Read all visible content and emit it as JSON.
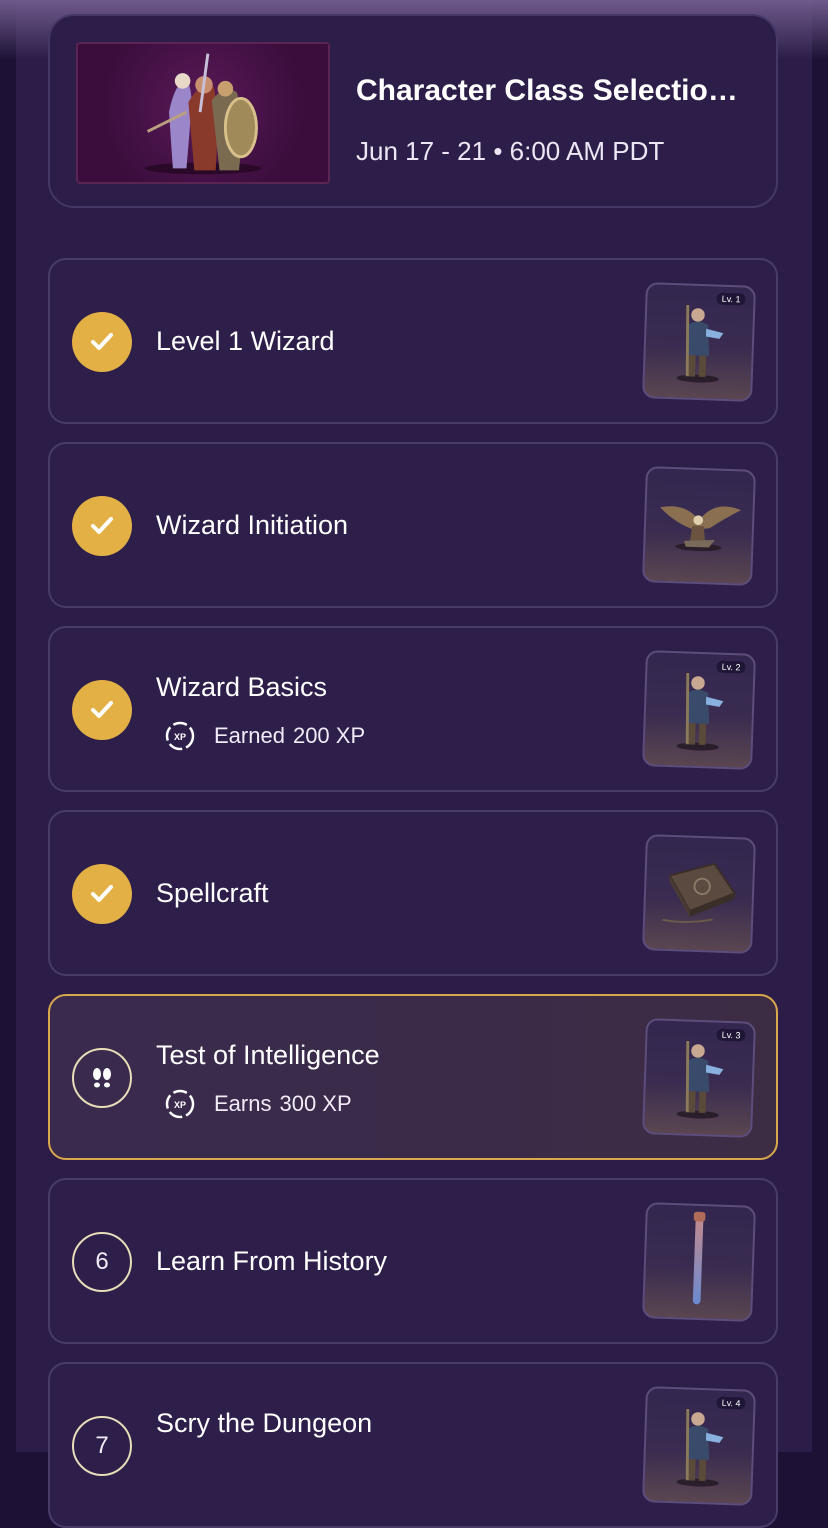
{
  "event": {
    "title": "Character Class Selectio…",
    "date": "Jun 17 - 21 • 6:00 AM PDT",
    "image": "adventurer-party-illustration"
  },
  "quests": [
    {
      "title": "Level 1 Wizard",
      "state": "completed",
      "reward": "wizard-figure",
      "level_badge": "Lv. 1"
    },
    {
      "title": "Wizard Initiation",
      "state": "completed",
      "reward": "eagle-figure"
    },
    {
      "title": "Wizard Basics",
      "state": "completed",
      "reward": "wizard-figure",
      "level_badge": "Lv. 2",
      "xp_label": "Earned",
      "xp_value": "200 XP"
    },
    {
      "title": "Spellcraft",
      "state": "completed",
      "reward": "spellbook"
    },
    {
      "title": "Test of Intelligence",
      "state": "in-progress",
      "reward": "wizard-figure",
      "level_badge": "Lv. 3",
      "xp_label": "Earns",
      "xp_value": "300 XP"
    },
    {
      "title": "Learn From History",
      "state": "locked",
      "number": "6",
      "reward": "staff"
    },
    {
      "title": "Scry the Dungeon",
      "state": "locked",
      "number": "7",
      "reward": "wizard-figure",
      "level_badge": "Lv. 4"
    }
  ],
  "xp_icon_text": "XP",
  "colors": {
    "background": "#2b1d47",
    "card": "#2e1f4a",
    "completed_badge": "#e3b046",
    "active_border": "#d9a84c"
  }
}
